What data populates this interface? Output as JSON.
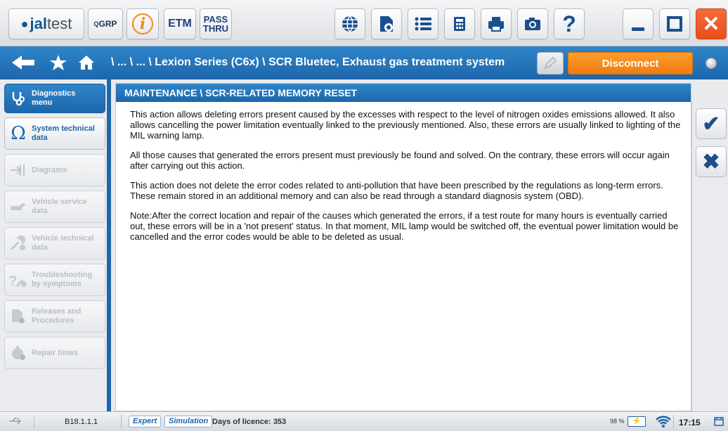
{
  "toolbar": {
    "logo_dot": "●",
    "logo_brand": "jal",
    "logo_suffix": "test",
    "grp_label": "GRP",
    "grp_prefix": "Q",
    "info_label": "i",
    "etm_label": "ETM",
    "pass_label_1": "PASS",
    "pass_label_2": "THRU",
    "help_label": "?",
    "close_label": "✕"
  },
  "nav": {
    "breadcrumb": "\\ ... \\ ... \\ Lexion Series (C6x) \\ SCR Bluetec, Exhaust gas treatment system",
    "disconnect_label": "Disconnect"
  },
  "sidebar": {
    "items": [
      {
        "label_1": "Diagnostics",
        "label_2": "menu",
        "icon": "stethoscope-icon",
        "state": "active"
      },
      {
        "label_1": "System technical",
        "label_2": "data",
        "icon": "omega-icon",
        "state": "enabled"
      },
      {
        "label_1": "Diagrams",
        "label_2": "",
        "icon": "diagram-icon",
        "state": "disabled"
      },
      {
        "label_1": "Vehicle service",
        "label_2": "data",
        "icon": "oil-can-icon",
        "state": "disabled"
      },
      {
        "label_1": "Vehicle technical",
        "label_2": "data",
        "icon": "wrench-gear-icon",
        "state": "disabled"
      },
      {
        "label_1": "Troubleshooting",
        "label_2": "by symptoms",
        "icon": "question-wrench-icon",
        "state": "disabled"
      },
      {
        "label_1": "Releases and",
        "label_2": "Procedures",
        "icon": "document-gear-icon",
        "state": "disabled"
      },
      {
        "label_1": "Repair times",
        "label_2": "",
        "icon": "stopwatch-gear-icon",
        "state": "disabled"
      }
    ]
  },
  "content": {
    "title": "MAINTENANCE \\ SCR-RELATED MEMORY RESET",
    "paragraphs": [
      "This action allows deleting errors present caused by the excesses with respect to the level of nitrogen oxides emissions allowed. It also allows cancelling the power limitation eventually linked to the previously mentioned. Also, these errors are usually linked to lighting of the MIL warning lamp.",
      "All those causes that generated the errors present must previously be found and solved. On the contrary, these errors will occur again after carrying out this action.",
      "This action does not delete the error codes related to anti-pollution that have been prescribed by the regulations as long-term errors. These remain stored in an additional memory and can also be read through a standard diagnosis system (OBD).",
      "Note:After the correct location and repair of the causes which generated the errors, if a test route for many hours is eventually carried out, these errors will be in a 'not present' status. In that moment, MIL lamp would be switched off, the eventual power limitation would be cancelled and the error codes would be able to be deleted as usual."
    ]
  },
  "actions": {
    "ok_label": "✔",
    "cancel_label": "✖"
  },
  "status": {
    "version": "B18.1.1.1",
    "mode_expert": "Expert",
    "mode_simulation": "Simulation",
    "licence": "Days of licence: 353",
    "battery_pct": "98 %",
    "battery_icon": "⚡",
    "time": "17:15"
  }
}
